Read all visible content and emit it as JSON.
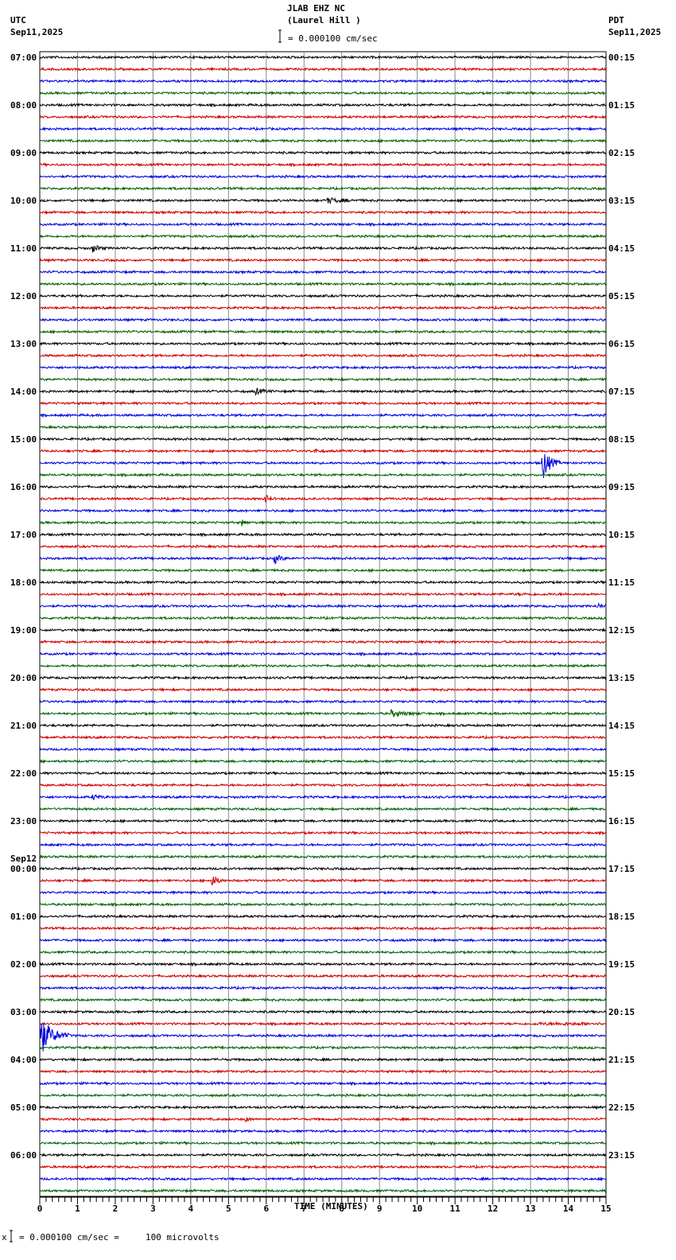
{
  "header": {
    "station": "JLAB EHZ NC",
    "location": "(Laurel Hill )",
    "left_tz": "UTC",
    "left_date": "Sep11,2025",
    "right_tz": "PDT",
    "right_date": "Sep11,2025",
    "scale_text": "= 0.000100 cm/sec"
  },
  "footer": {
    "scale_text": "= 0.000100 cm/sec =     100 microvolts",
    "prefix": "x"
  },
  "chart_data": {
    "type": "line",
    "title": "JLAB EHZ NC (Laurel Hill )",
    "xlabel": "TIME (MINUTES)",
    "xlim": [
      0,
      15
    ],
    "x_ticks": [
      "0",
      "1",
      "2",
      "3",
      "4",
      "5",
      "6",
      "7",
      "8",
      "9",
      "10",
      "11",
      "12",
      "13",
      "14",
      "15"
    ],
    "traces_per_hour": 4,
    "trace_colors": [
      "#000000",
      "#d00000",
      "#0000e0",
      "#006000"
    ],
    "date_change_label": "Sep12",
    "date_change_hour_index": 17,
    "utc_labels": [
      "07:00",
      "08:00",
      "09:00",
      "10:00",
      "11:00",
      "12:00",
      "13:00",
      "14:00",
      "15:00",
      "16:00",
      "17:00",
      "18:00",
      "19:00",
      "20:00",
      "21:00",
      "22:00",
      "23:00",
      "00:00",
      "01:00",
      "02:00",
      "03:00",
      "04:00",
      "05:00",
      "06:00"
    ],
    "pdt_labels": [
      "00:15",
      "01:15",
      "02:15",
      "03:15",
      "04:15",
      "05:15",
      "06:15",
      "07:15",
      "08:15",
      "09:15",
      "10:15",
      "11:15",
      "12:15",
      "13:15",
      "14:15",
      "15:15",
      "16:15",
      "17:15",
      "18:15",
      "19:15",
      "20:15",
      "21:15",
      "22:15",
      "23:15"
    ],
    "background_noise_amplitude": 1.6,
    "events": [
      {
        "trace": 12,
        "minute": 7.6,
        "duration": 1.0,
        "amplitude": 3
      },
      {
        "trace": 16,
        "minute": 1.4,
        "duration": 0.4,
        "amplitude": 5
      },
      {
        "trace": 28,
        "minute": 5.7,
        "duration": 0.5,
        "amplitude": 4
      },
      {
        "trace": 33,
        "minute": 7.2,
        "duration": 0.4,
        "amplitude": 3
      },
      {
        "trace": 34,
        "minute": 13.3,
        "duration": 0.5,
        "amplitude": 24
      },
      {
        "trace": 37,
        "minute": 5.95,
        "duration": 0.3,
        "amplitude": 6
      },
      {
        "trace": 39,
        "minute": 5.35,
        "duration": 0.2,
        "amplitude": 5
      },
      {
        "trace": 42,
        "minute": 6.2,
        "duration": 0.4,
        "amplitude": 7
      },
      {
        "trace": 45,
        "minute": 12.4,
        "duration": 1.6,
        "amplitude": 3
      },
      {
        "trace": 46,
        "minute": 14.75,
        "duration": 0.25,
        "amplitude": 5
      },
      {
        "trace": 55,
        "minute": 9.3,
        "duration": 0.9,
        "amplitude": 4
      },
      {
        "trace": 62,
        "minute": 1.4,
        "duration": 0.5,
        "amplitude": 3
      },
      {
        "trace": 69,
        "minute": 4.55,
        "duration": 0.3,
        "amplitude": 11
      },
      {
        "trace": 81,
        "minute": 13.0,
        "duration": 2.0,
        "amplitude": 7
      },
      {
        "trace": 82,
        "minute": 0.0,
        "duration": 0.8,
        "amplitude": 26
      },
      {
        "trace": 89,
        "minute": 5.4,
        "duration": 0.3,
        "amplitude": 4
      }
    ]
  }
}
